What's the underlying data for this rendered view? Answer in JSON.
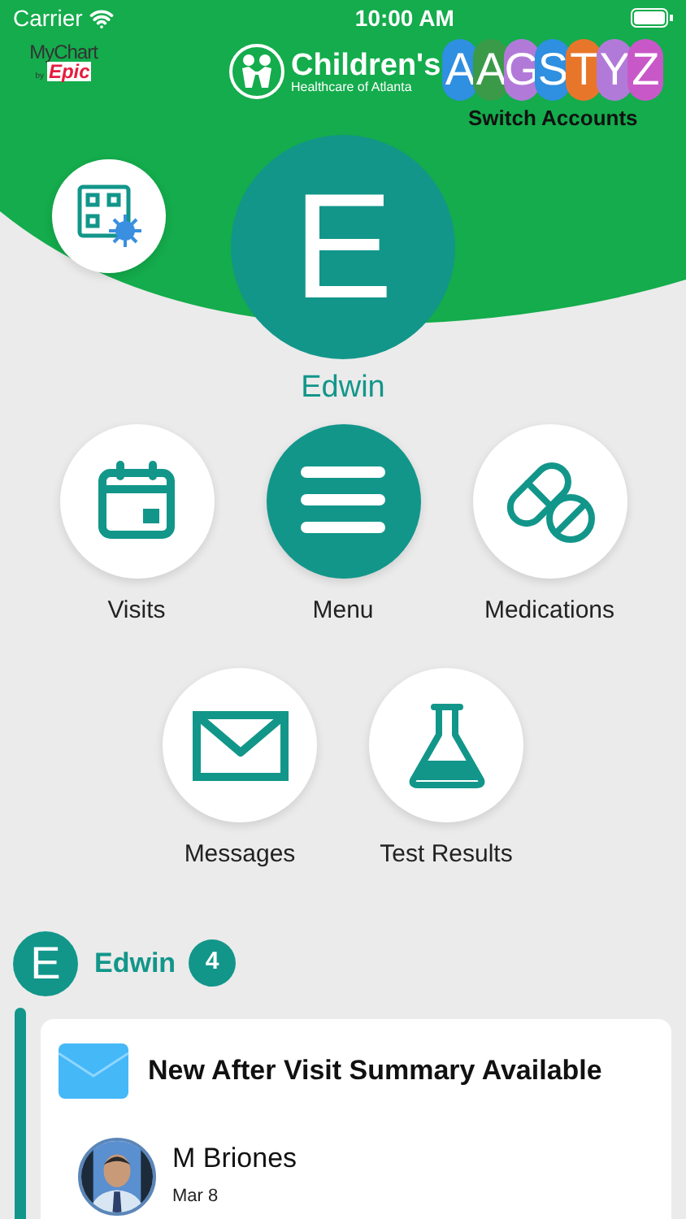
{
  "status_bar": {
    "carrier": "Carrier",
    "time": "10:00 AM"
  },
  "header": {
    "app_logo": {
      "name": "MyChart",
      "by": "by",
      "brand": "Epic"
    },
    "org_logo": {
      "name": "Children's",
      "tagline": "Healthcare of Atlanta"
    },
    "accounts": [
      {
        "letter": "A",
        "color": "#2f8fe0"
      },
      {
        "letter": "A",
        "color": "#3b9a48"
      },
      {
        "letter": "G",
        "color": "#b27ad8"
      },
      {
        "letter": "S",
        "color": "#2f8fe0"
      },
      {
        "letter": "T",
        "color": "#e8762a"
      },
      {
        "letter": "Y",
        "color": "#b27ad8"
      },
      {
        "letter": "Z",
        "color": "#c858c8"
      }
    ],
    "switch_label": "Switch Accounts"
  },
  "profile": {
    "initial": "E",
    "name": "Edwin"
  },
  "shortcuts": [
    {
      "kind": "calendar",
      "label": "Visits",
      "selected": false
    },
    {
      "kind": "menu",
      "label": "Menu",
      "selected": true
    },
    {
      "kind": "pill",
      "label": "Medications",
      "selected": false
    },
    {
      "kind": "mail",
      "label": "Messages",
      "selected": false
    },
    {
      "kind": "flask",
      "label": "Test Results",
      "selected": false
    }
  ],
  "feed": {
    "initial": "E",
    "name": "Edwin",
    "count": "4",
    "card": {
      "title": "New After Visit Summary Available",
      "sender": "M Briones",
      "date": "Mar 8"
    }
  }
}
